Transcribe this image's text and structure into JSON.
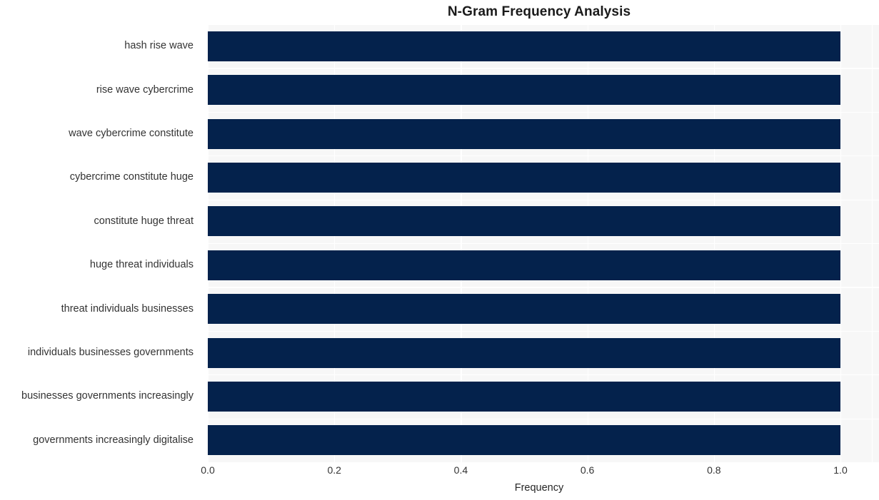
{
  "chart_data": {
    "type": "bar",
    "orientation": "horizontal",
    "title": "N-Gram Frequency Analysis",
    "xlabel": "Frequency",
    "ylabel": "",
    "xlim": [
      0.0,
      1.0
    ],
    "grid": true,
    "legend": null,
    "bar_color": "#04224c",
    "plot_background": "#f7f7f7",
    "gridline_color": "#ffffff",
    "figure_background": "#ffffff",
    "categories": [
      "hash rise wave",
      "rise wave cybercrime",
      "wave cybercrime constitute",
      "cybercrime constitute huge",
      "constitute huge threat",
      "huge threat individuals",
      "threat individuals businesses",
      "individuals businesses governments",
      "businesses governments increasingly",
      "governments increasingly digitalise"
    ],
    "values": [
      1.0,
      1.0,
      1.0,
      1.0,
      1.0,
      1.0,
      1.0,
      1.0,
      1.0,
      1.0
    ],
    "xticks": [
      "0.0",
      "0.2",
      "0.4",
      "0.6",
      "0.8",
      "1.0"
    ],
    "xtick_values": [
      0.0,
      0.2,
      0.4,
      0.6,
      0.8,
      1.0
    ]
  }
}
